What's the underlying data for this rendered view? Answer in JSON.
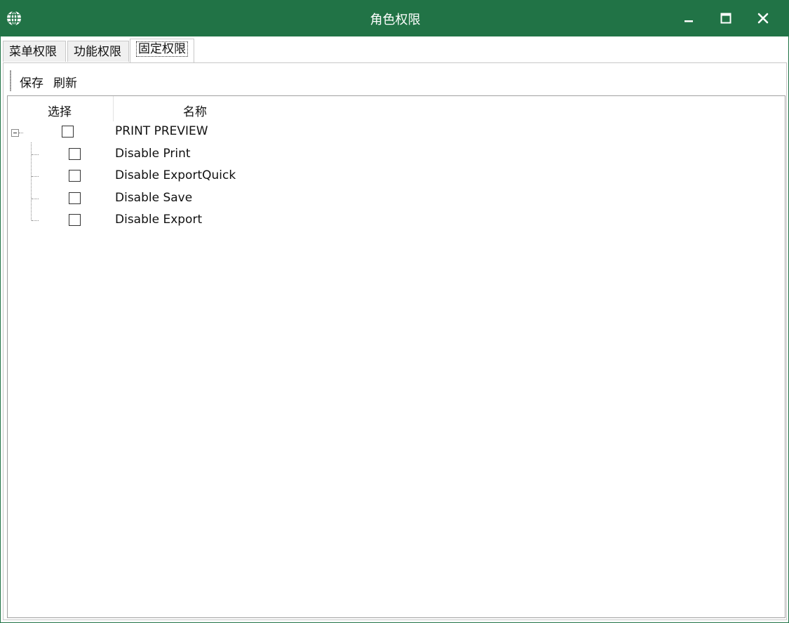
{
  "window": {
    "title": "角色权限",
    "icon": "globe-icon",
    "controls": [
      "minimize-icon",
      "maximize-icon",
      "close-icon"
    ],
    "accent_color": "#217346"
  },
  "tabs": [
    {
      "label": "菜单权限",
      "active": false
    },
    {
      "label": "功能权限",
      "active": false
    },
    {
      "label": "固定权限",
      "active": true
    }
  ],
  "toolbar": {
    "save_label": "保存",
    "refresh_label": "刷新"
  },
  "tree": {
    "columns": {
      "select": "选择",
      "name": "名称"
    },
    "root": {
      "label": "PRINT PREVIEW",
      "checked": false,
      "expanded": true
    },
    "children": [
      {
        "label": "Disable Print",
        "checked": false
      },
      {
        "label": "Disable ExportQuick",
        "checked": false
      },
      {
        "label": "Disable Save",
        "checked": false
      },
      {
        "label": "Disable Export",
        "checked": false
      }
    ]
  }
}
